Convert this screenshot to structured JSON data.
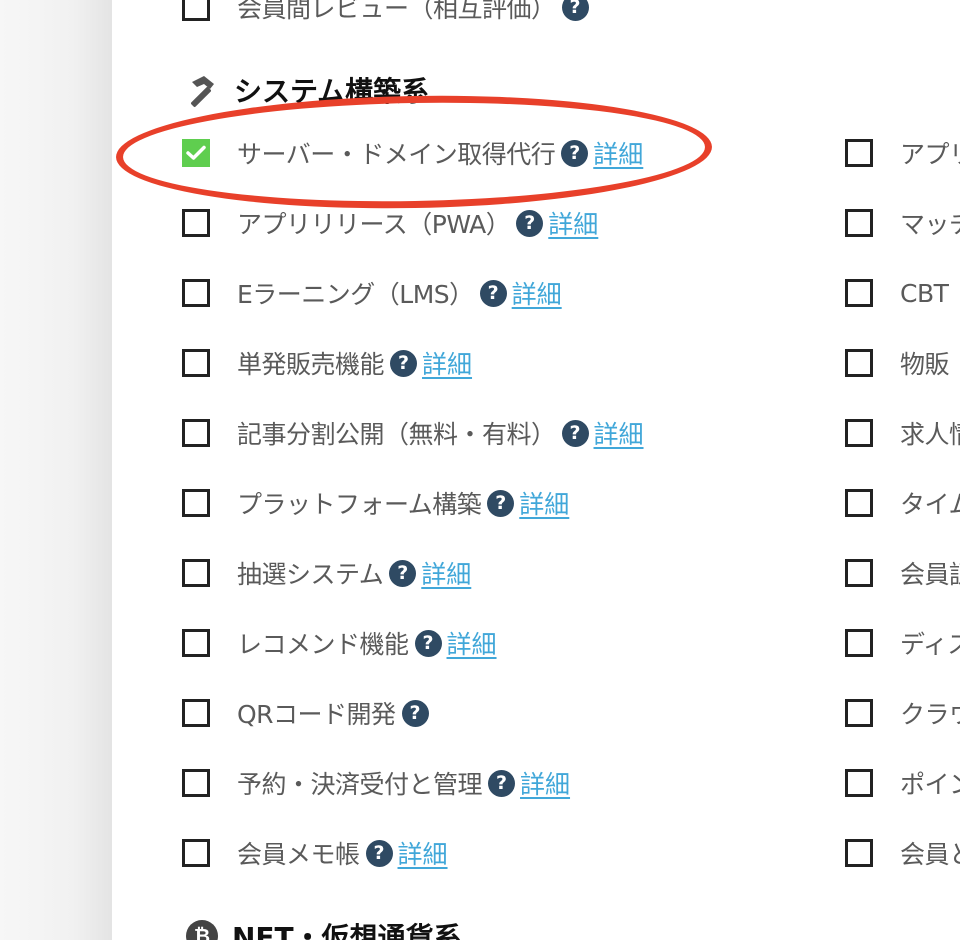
{
  "top_item": {
    "label": "会員間レビュー（相互評価）"
  },
  "section_system": {
    "title": "システム構築系"
  },
  "section_nft": {
    "title": "NFT・仮想通貨系",
    "icon_glyph": "₿"
  },
  "help_glyph": "?",
  "left_items": [
    {
      "label": "サーバー・ドメイン取得代行",
      "checked": true,
      "detail": "詳細"
    },
    {
      "label": "アプリリリース（PWA）",
      "checked": false,
      "detail": "詳細"
    },
    {
      "label": "Eラーニング（LMS）",
      "checked": false,
      "detail": "詳細"
    },
    {
      "label": "単発販売機能",
      "checked": false,
      "detail": "詳細"
    },
    {
      "label": "記事分割公開（無料・有料）",
      "checked": false,
      "detail": "詳細"
    },
    {
      "label": "プラットフォーム構築",
      "checked": false,
      "detail": "詳細"
    },
    {
      "label": "抽選システム",
      "checked": false,
      "detail": "詳細"
    },
    {
      "label": "レコメンド機能",
      "checked": false,
      "detail": "詳細"
    },
    {
      "label": "QRコード開発",
      "checked": false
    },
    {
      "label": "予約・決済受付と管理",
      "checked": false,
      "detail": "詳細"
    },
    {
      "label": "会員メモ帳",
      "checked": false,
      "detail": "詳細"
    }
  ],
  "right_items": [
    {
      "label": "アプリ",
      "checked": false
    },
    {
      "label": "マッチ",
      "checked": false
    },
    {
      "label": "CBT",
      "checked": false
    },
    {
      "label": "物販",
      "checked": false
    },
    {
      "label": "求人情",
      "checked": false
    },
    {
      "label": "タイム",
      "checked": false
    },
    {
      "label": "会員証",
      "checked": false
    },
    {
      "label": "ディス",
      "checked": false
    },
    {
      "label": "クラウ",
      "checked": false
    },
    {
      "label": "ポイン",
      "checked": false
    },
    {
      "label": "会員と",
      "checked": false
    }
  ],
  "colors": {
    "checked_green": "#5fce4f",
    "help_navy": "#2f4a63",
    "link_blue": "#41a7d9",
    "annotation_red": "#e8402a"
  }
}
